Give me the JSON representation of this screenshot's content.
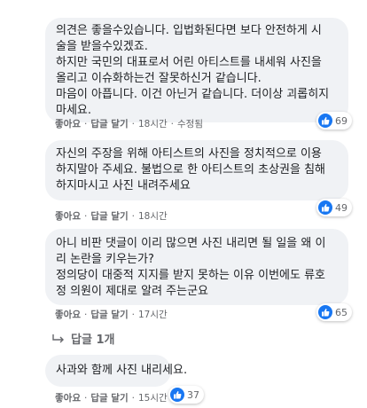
{
  "colors": {
    "bubble": "#f0f2f5",
    "like": "#1877f2",
    "meta": "#65676b"
  },
  "comments": [
    {
      "lines": [
        "의견은 좋을수있습니다. 입법화된다면 보다 안전하게 시",
        "술을 받을수있겠죠.",
        "하지만 국민의 대표로서 어린 아티스트를 내세워 사진을",
        "올리고 이슈화하는건 잘못하신거 같습니다.",
        "마음이 아픕니다. 이건 아닌거 같습니다. 더이상 괴롭히지",
        "마세요."
      ],
      "like": "좋아요",
      "reply": "답글 달기",
      "time": "18시간",
      "edited": "수정됨",
      "reactions": "69",
      "reaction_icon": "thumbs-up-icon"
    },
    {
      "lines": [
        "자신의 주장을 위해 아티스트의 사진을 정치적으로 이용",
        "하지말아 주세요. 불법으로 한 아티스트의 초상권을 침해",
        "하지마시고 사진 내려주세요"
      ],
      "like": "좋아요",
      "reply": "답글 달기",
      "time": "18시간",
      "reactions": "49",
      "reaction_icon": "thumbs-up-icon"
    },
    {
      "lines": [
        "아니 비판 댓글이 이리 많으면 사진 내리면 될 일을 왜 이",
        "리 논란을 키우는가?",
        "정의당이 대중적 지지를 받지 못하는 이유 이번에도 류호",
        "정 의원이 제대로 알려 주는군요"
      ],
      "like": "좋아요",
      "reply": "답글 달기",
      "time": "17시간",
      "reactions": "65",
      "reaction_icon": "thumbs-up-icon",
      "replies_label": "답글 1개"
    },
    {
      "lines": [
        "사과와 함께 사진 내리세요."
      ],
      "like": "좋아요",
      "reply": "답글 달기",
      "time": "15시간",
      "reactions": "37",
      "reaction_icon": "thumbs-up-icon"
    }
  ]
}
